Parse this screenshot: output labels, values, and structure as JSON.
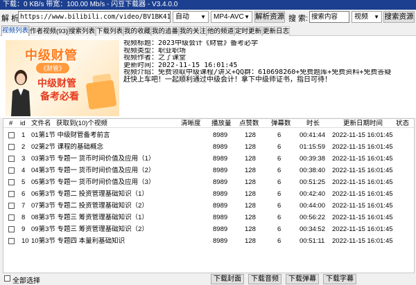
{
  "window": {
    "title": "下载：0 KB/s  带宽：100.00 Mb/s - 闪豆下载器 - V3.4.0.0"
  },
  "toolbar": {
    "url_label": "解 析:",
    "url_value": "https://www.bilibili.com/video/BV1BK411Z7gZ/?spm_id_f",
    "quality_value": "自动",
    "format_value": "MP4-AVC",
    "parse_button": "解析资源",
    "search_label": "搜 索:",
    "search_value": "搜索内容",
    "search_type_value": "视频",
    "search_button": "搜索资源"
  },
  "tabs": [
    {
      "label": "视频列表"
    },
    {
      "label": "作者视频(93)"
    },
    {
      "label": "搜索列表"
    },
    {
      "label": "下载列表"
    },
    {
      "label": "我的收藏"
    },
    {
      "label": "我的追番"
    },
    {
      "label": "我的关注"
    },
    {
      "label": "他的频道"
    },
    {
      "label": "定时更新"
    },
    {
      "label": "更新日志"
    }
  ],
  "thumbnail": {
    "line1": "中级财管",
    "badge": "《财管》",
    "line2": "中级财管",
    "line3": "备考必看"
  },
  "video_info": {
    "title": "视频标题：2023中级会计《财管》备考必学",
    "type": "视频类型：职业职场",
    "author": "视频作者：之了课堂",
    "updated": "更新时间：2022-11-15 16:01:45",
    "intro": "视频介绍：免费领取中级课程/讲义+QQ群：610698260+免费题库+免费资料+免费答疑  赶快上车吧！一起顺利通过中级会计！拿下中级师证书，指日可待！"
  },
  "table": {
    "headers": {
      "hash": "#",
      "id": "id",
      "filename": "文件名",
      "fetched": "获取到(10)个视频",
      "quality": "清晰度",
      "plays": "播放量",
      "likes": "点赞数",
      "danmaku": "弹幕数",
      "duration": "时长",
      "updated": "更新日期时间",
      "status": "状态"
    },
    "rows": [
      {
        "id": "1",
        "name": "01第1节 中级财管备考前言",
        "plays": "8989",
        "likes": "128",
        "danmaku": "6",
        "duration": "00:41:44",
        "updated": "2022-11-15 16:01:45"
      },
      {
        "id": "2",
        "name": "02第2节 课程的基础概念",
        "plays": "8989",
        "likes": "128",
        "danmaku": "6",
        "duration": "01:15:59",
        "updated": "2022-11-15 16:01:45"
      },
      {
        "id": "3",
        "name": "03第3节 专题一 货币时间价值及应用（1）",
        "plays": "8989",
        "likes": "128",
        "danmaku": "6",
        "duration": "00:39:38",
        "updated": "2022-11-15 16:01:45"
      },
      {
        "id": "4",
        "name": "04第3节 专题一 货币时间价值及应用（2）",
        "plays": "8989",
        "likes": "128",
        "danmaku": "6",
        "duration": "00:38:40",
        "updated": "2022-11-15 16:01:45"
      },
      {
        "id": "5",
        "name": "05第3节 专题一 货币时间价值及应用（3）",
        "plays": "8989",
        "likes": "128",
        "danmaku": "6",
        "duration": "00:51:25",
        "updated": "2022-11-15 16:01:45"
      },
      {
        "id": "6",
        "name": "06第3节 专题二 投资管理基础知识（1）",
        "plays": "8989",
        "likes": "128",
        "danmaku": "6",
        "duration": "00:42:40",
        "updated": "2022-11-15 16:01:45"
      },
      {
        "id": "7",
        "name": "07第3节 专题二 投资管理基础知识（2）",
        "plays": "8989",
        "likes": "128",
        "danmaku": "6",
        "duration": "00:44:00",
        "updated": "2022-11-15 16:01:45"
      },
      {
        "id": "8",
        "name": "08第3节 专题三 筹资管理基础知识（1）",
        "plays": "8989",
        "likes": "128",
        "danmaku": "6",
        "duration": "00:56:22",
        "updated": "2022-11-15 16:01:45"
      },
      {
        "id": "9",
        "name": "09第3节 专题三 筹资管理基础知识（2）",
        "plays": "8989",
        "likes": "128",
        "danmaku": "6",
        "duration": "00:34:52",
        "updated": "2022-11-15 16:01:45"
      },
      {
        "id": "10",
        "name": "10第3节 专题四 本量利基础知识",
        "plays": "8989",
        "likes": "128",
        "danmaku": "6",
        "duration": "00:51:11",
        "updated": "2022-11-15 16:01:45"
      }
    ]
  },
  "footer": {
    "select_all": "全部选择",
    "download_cover": "下载封面",
    "download_audio": "下载音频",
    "download_danmaku": "下载弹幕",
    "download_subtitle": "下载字幕"
  },
  "colors": {
    "titlebar": "#1c3f8f",
    "accent_orange": "#ff7a1a",
    "accent_red": "#e63b1f"
  }
}
